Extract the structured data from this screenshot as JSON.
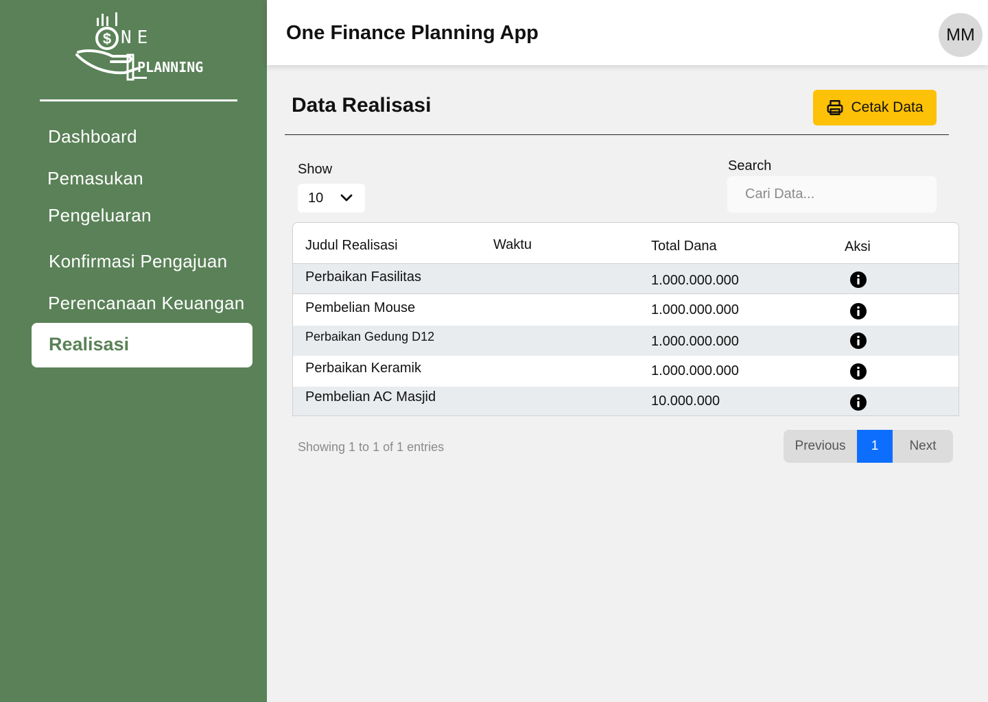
{
  "logo": {
    "line1": "NE",
    "line2": "PLANNING"
  },
  "sidebar": {
    "items": [
      {
        "label": "Dashboard"
      },
      {
        "label": "Pemasukan"
      },
      {
        "label": "Pengeluaran"
      },
      {
        "label": "Konfirmasi Pengajuan"
      },
      {
        "label": "Perencanaan Keuangan"
      },
      {
        "label": "Realisasi"
      }
    ],
    "active": "Realisasi"
  },
  "header": {
    "title": "One Finance Planning App",
    "avatar_initials": "MM"
  },
  "main": {
    "title": "Data Realisasi",
    "print_label": "Cetak Data",
    "show_label": "Show",
    "show_value": "10",
    "search_label": "Search",
    "search_placeholder": "Cari Data...",
    "search_value": ""
  },
  "table": {
    "columns": [
      "Judul Realisasi",
      "Waktu",
      "Total Dana",
      "Aksi"
    ],
    "rows": [
      {
        "judul": "Perbaikan Fasilitas",
        "waktu": "",
        "total": "1.000.000.000",
        "aksi_icon": "info-icon"
      },
      {
        "judul": "Pembelian Mouse",
        "waktu": "",
        "total": "1.000.000.000",
        "aksi_icon": "info-icon"
      },
      {
        "judul": "Perbaikan Gedung D12",
        "waktu": "",
        "total": "1.000.000.000",
        "aksi_icon": "info-icon"
      },
      {
        "judul": "Perbaikan Keramik",
        "waktu": "",
        "total": "1.000.000.000",
        "aksi_icon": "info-icon"
      },
      {
        "judul": "Pembelian AC Masjid",
        "waktu": "",
        "total": "10.000.000",
        "aksi_icon": "info-icon"
      }
    ]
  },
  "footer": {
    "entries_text": "Showing 1 to 1 of 1 entries",
    "previous_label": "Previous",
    "page": "1",
    "next_label": "Next"
  },
  "colors": {
    "sidebar": "#5a8157",
    "print_button": "#fdc107",
    "active_page": "#0d6efd",
    "row_shade": "#e9ecef"
  }
}
